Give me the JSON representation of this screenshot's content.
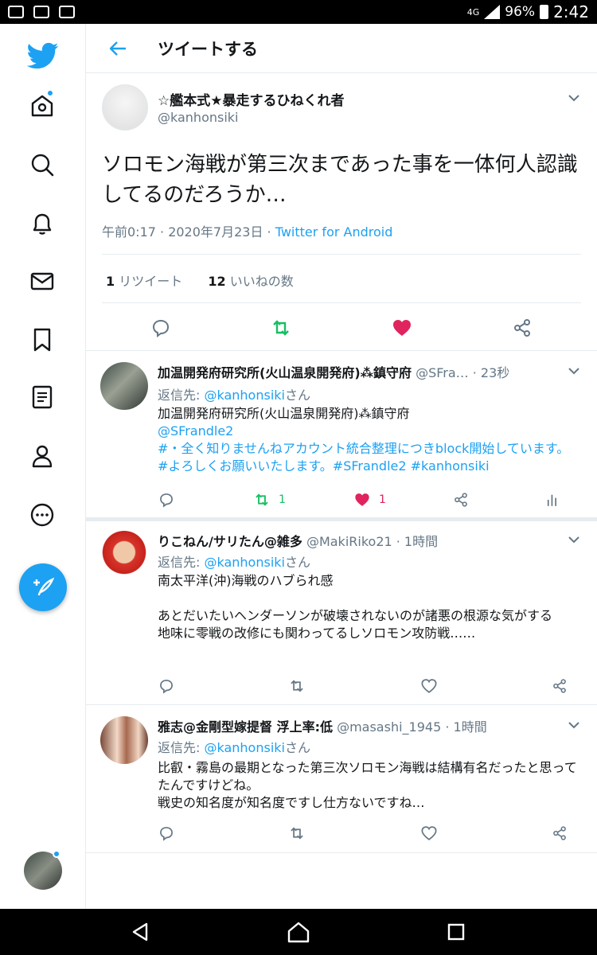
{
  "status_bar": {
    "battery": "96%",
    "time": "2:42",
    "network": "4G"
  },
  "header": {
    "title": "ツイートする"
  },
  "main_tweet": {
    "name": "☆艦本式★暴走するひねくれ者",
    "handle": "@kanhonsiki",
    "text": "ソロモン海戦が第三次まであった事を一体何人認識してるのだろうか…",
    "time": "午前0:17 · 2020年7月23日 · ",
    "source": "Twitter for Android",
    "retweets_count": "1",
    "retweets_label": " リツイート",
    "likes_count": "12",
    "likes_label": " いいねの数"
  },
  "replies": [
    {
      "name": "加温開発府研究所(火山温泉開発府)⁂鎮守府",
      "handle": " @SFra…",
      "time": " · 23秒",
      "reply_to_prefix": "返信先: ",
      "reply_to_handle": "@kanhonsiki",
      "reply_to_suffix": "さん",
      "body_text": "加温開発府研究所(火山温泉開発府)⁂鎮守府\n",
      "body_link": "@SFrandle2\n#・全く知りませんねアカウント統合整理につきblock開始しています。#よろしくお願いいたします。#SFrandle2 #kanhonsiki",
      "retweets": "1",
      "likes": "1"
    },
    {
      "name": "りこねん/サリたん@雑多",
      "handle": " @MakiRiko21",
      "time": " · 1時間",
      "reply_to_prefix": "返信先: ",
      "reply_to_handle": "@kanhonsiki",
      "reply_to_suffix": "さん",
      "body_text": "南太平洋(沖)海戦のハブられ感\n\nあとだいたいヘンダーソンが破壊されないのが諸悪の根源な気がする\n地味に零戦の改修にも関わってるしソロモン攻防戦……"
    },
    {
      "name": "雅志@金剛型嫁提督 浮上率:低",
      "handle": " @masashi_1945",
      "time": " · 1時間",
      "reply_to_prefix": "返信先: ",
      "reply_to_handle": "@kanhonsiki",
      "reply_to_suffix": "さん",
      "body_text": "比叡・霧島の最期となった第三次ソロモン海戦は結構有名だったと思ってたんですけどね。\n戦史の知名度が知名度ですし仕方ないですね…"
    }
  ],
  "colors": {
    "accent": "#1da1f2",
    "like": "#e0245e",
    "retweet": "#17bf63",
    "muted": "#657786"
  }
}
